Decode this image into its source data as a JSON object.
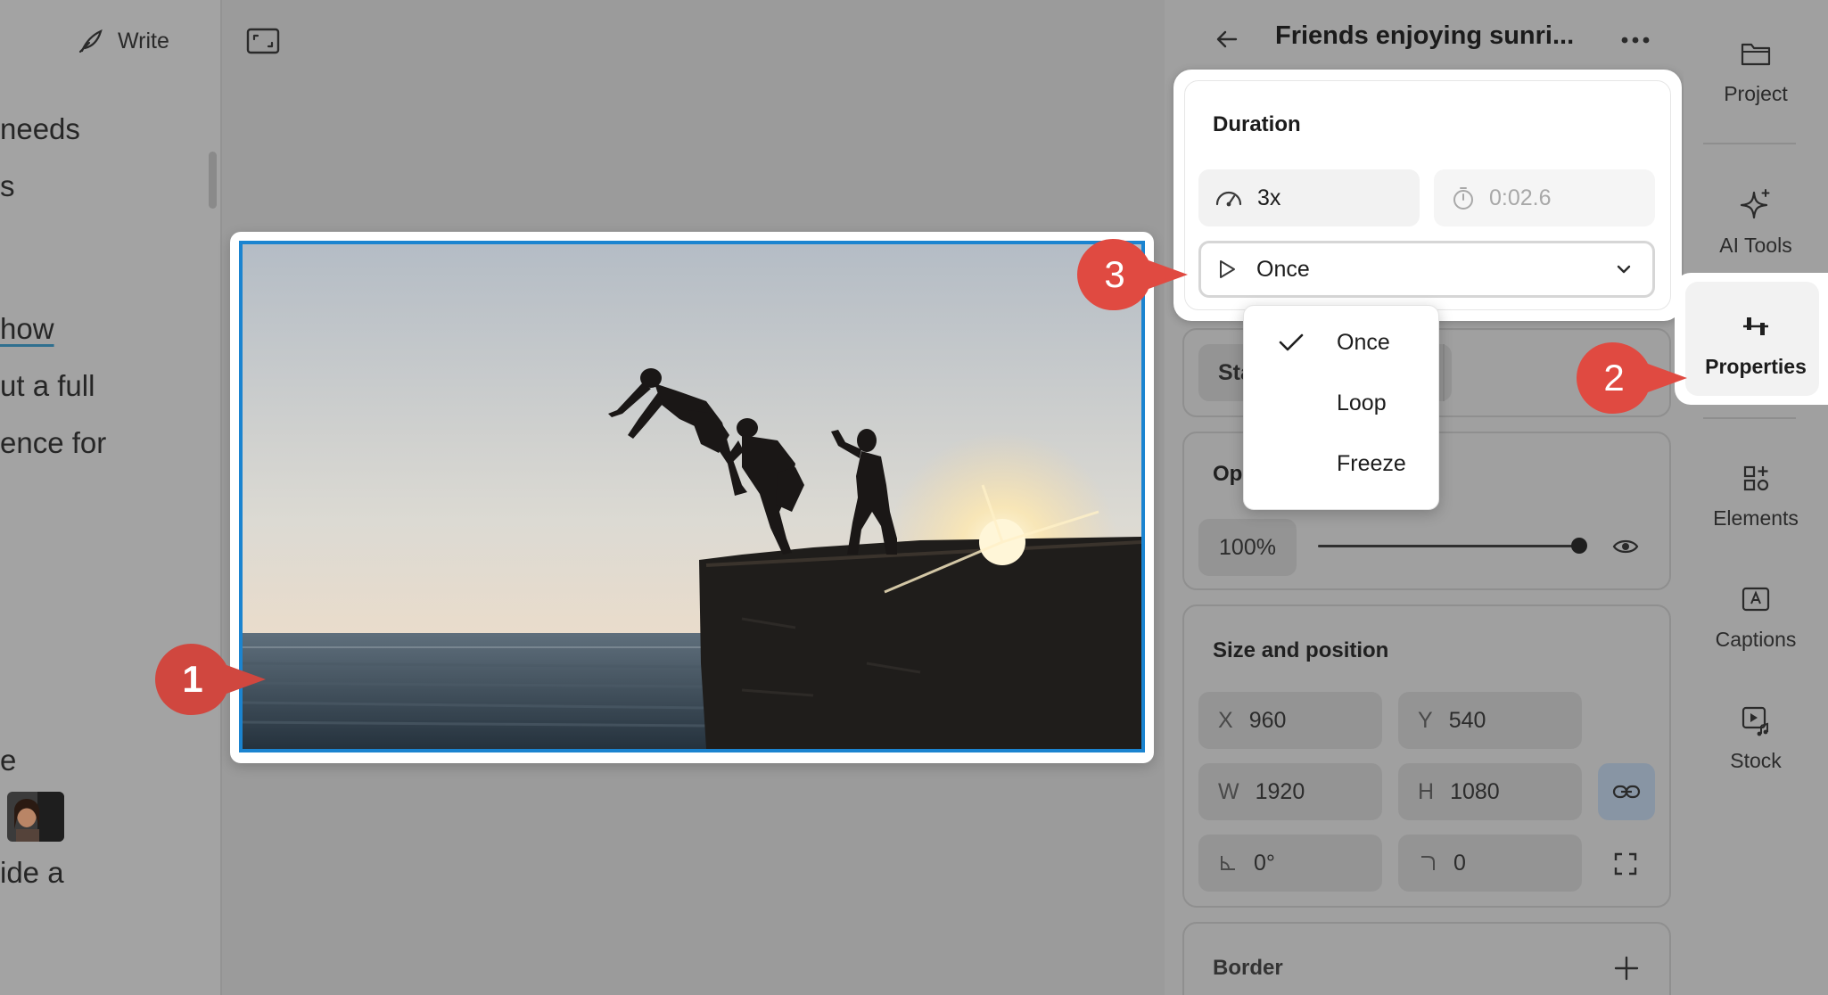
{
  "left_pane": {
    "write_label": "Write",
    "script_lines": [
      " needs",
      "s",
      "how",
      "ut a full",
      "ence for",
      "e",
      "ide a"
    ]
  },
  "properties": {
    "title": "Friends enjoying sunri...",
    "duration": {
      "title": "Duration",
      "speed": "3x",
      "time": "0:02.6",
      "playback_value": "Once",
      "menu_options": [
        "Once",
        "Loop",
        "Freeze"
      ],
      "selected_option": "Once"
    },
    "start_label": "Star",
    "opacity": {
      "label": "Opa",
      "value": "100%",
      "level": 1.0
    },
    "size_position": {
      "title": "Size and position",
      "x_label": "X",
      "x": "960",
      "y_label": "Y",
      "y": "540",
      "w_label": "W",
      "w": "1920",
      "h_label": "H",
      "h": "1080",
      "rotation": "0°",
      "corner": "0"
    },
    "border": {
      "title": "Border"
    }
  },
  "rail": {
    "items": [
      {
        "label": "Project",
        "icon": "folder-icon"
      },
      {
        "label": "AI Tools",
        "icon": "sparkle-icon"
      },
      {
        "label": "Properties",
        "icon": "sliders-icon"
      },
      {
        "label": "Elements",
        "icon": "shapes-icon"
      },
      {
        "label": "Captions",
        "icon": "captions-icon"
      },
      {
        "label": "Stock",
        "icon": "stock-icon"
      }
    ],
    "active": "Properties"
  },
  "callouts": [
    "1",
    "2",
    "3"
  ],
  "colors": {
    "selection": "#1b84d0",
    "callout": "#e04a41",
    "overlay": "#9b9b9b"
  }
}
